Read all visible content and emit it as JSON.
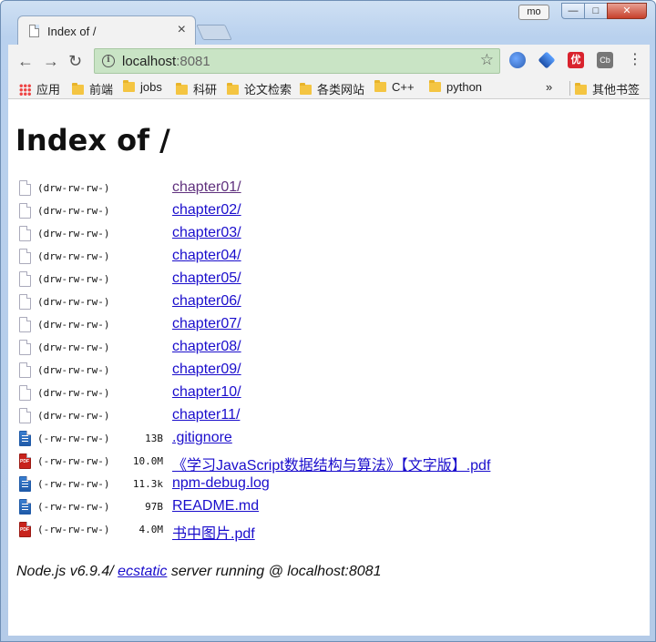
{
  "window": {
    "user_label": "mo",
    "min_glyph": "—",
    "max_glyph": "□",
    "close_glyph": "✕"
  },
  "tab": {
    "title": "Index of /",
    "close_glyph": "×"
  },
  "toolbar": {
    "back_glyph": "←",
    "forward_glyph": "→",
    "reload_glyph": "↻",
    "url_host": "localhost",
    "url_port": ":8081",
    "star_glyph": "☆",
    "ext3_text": "优",
    "ext4_text": "Cb",
    "menu_glyph": "⋮"
  },
  "bookmarks": {
    "apps": "应用",
    "items": [
      "前端",
      "jobs",
      "科研",
      "论文检索",
      "各类网站",
      "C++",
      "python"
    ],
    "overflow": "»",
    "other": "其他书签"
  },
  "page": {
    "heading": "Index of /",
    "entries": [
      {
        "perm": "(drw-rw-rw-)",
        "size": "",
        "name": "chapter01/",
        "kind": "dir",
        "visited": true
      },
      {
        "perm": "(drw-rw-rw-)",
        "size": "",
        "name": "chapter02/",
        "kind": "dir"
      },
      {
        "perm": "(drw-rw-rw-)",
        "size": "",
        "name": "chapter03/",
        "kind": "dir"
      },
      {
        "perm": "(drw-rw-rw-)",
        "size": "",
        "name": "chapter04/",
        "kind": "dir"
      },
      {
        "perm": "(drw-rw-rw-)",
        "size": "",
        "name": "chapter05/",
        "kind": "dir"
      },
      {
        "perm": "(drw-rw-rw-)",
        "size": "",
        "name": "chapter06/",
        "kind": "dir"
      },
      {
        "perm": "(drw-rw-rw-)",
        "size": "",
        "name": "chapter07/",
        "kind": "dir"
      },
      {
        "perm": "(drw-rw-rw-)",
        "size": "",
        "name": "chapter08/",
        "kind": "dir"
      },
      {
        "perm": "(drw-rw-rw-)",
        "size": "",
        "name": "chapter09/",
        "kind": "dir"
      },
      {
        "perm": "(drw-rw-rw-)",
        "size": "",
        "name": "chapter10/",
        "kind": "dir"
      },
      {
        "perm": "(drw-rw-rw-)",
        "size": "",
        "name": "chapter11/",
        "kind": "dir"
      },
      {
        "perm": "(-rw-rw-rw-)",
        "size": "13B",
        "name": ".gitignore",
        "kind": "text"
      },
      {
        "perm": "(-rw-rw-rw-)",
        "size": "10.0M",
        "name": "《学习JavaScript数据结构与算法》【文字版】.pdf",
        "kind": "pdf"
      },
      {
        "perm": "(-rw-rw-rw-)",
        "size": "11.3k",
        "name": "npm-debug.log",
        "kind": "text"
      },
      {
        "perm": "(-rw-rw-rw-)",
        "size": "97B",
        "name": "README.md",
        "kind": "text"
      },
      {
        "perm": "(-rw-rw-rw-)",
        "size": "4.0M",
        "name": "书中图片.pdf",
        "kind": "pdf"
      }
    ],
    "footer": {
      "prefix": "Node.js v6.9.4/ ",
      "link": "ecstatic",
      "suffix": " server running @ localhost:8081"
    }
  }
}
